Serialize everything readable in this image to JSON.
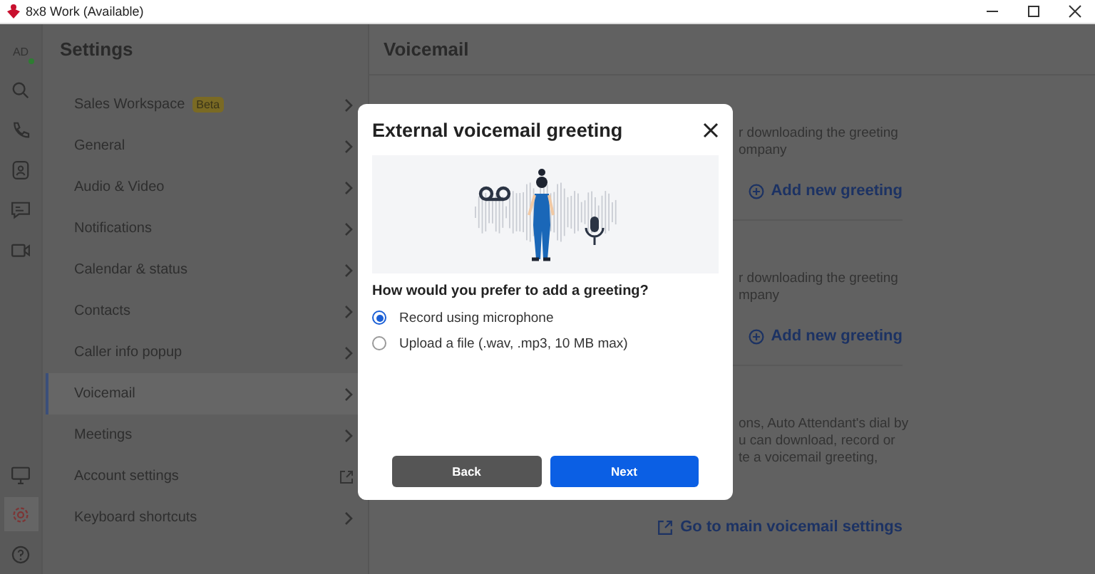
{
  "title_bar": {
    "title": "8x8 Work (Available)"
  },
  "rail": {
    "avatar": {
      "initials": "AD"
    },
    "items": [
      {
        "kind": "search",
        "selected": false
      },
      {
        "kind": "phone",
        "selected": false
      },
      {
        "kind": "contacts",
        "selected": false
      },
      {
        "kind": "chat",
        "selected": false
      },
      {
        "kind": "video",
        "selected": false
      }
    ],
    "bottom_items": [
      {
        "kind": "monitor",
        "selected": false
      },
      {
        "kind": "settings",
        "selected": true
      },
      {
        "kind": "help",
        "selected": false
      }
    ]
  },
  "settings": {
    "title": "Settings",
    "items": [
      {
        "label": "Sales Workspace",
        "badge": "Beta",
        "kind": "page",
        "selected": false
      },
      {
        "label": "General",
        "kind": "page",
        "selected": false
      },
      {
        "label": "Audio & Video",
        "kind": "page",
        "selected": false
      },
      {
        "label": "Notifications",
        "kind": "page",
        "selected": false
      },
      {
        "label": "Calendar & status",
        "kind": "page",
        "selected": false
      },
      {
        "label": "Contacts",
        "kind": "page",
        "selected": false
      },
      {
        "label": "Caller info popup",
        "kind": "page",
        "selected": false
      },
      {
        "label": "Voicemail",
        "kind": "page",
        "selected": true
      },
      {
        "label": "Meetings",
        "kind": "page",
        "selected": false
      },
      {
        "label": "Account settings",
        "kind": "external",
        "selected": false
      },
      {
        "label": "Keyboard shortcuts",
        "kind": "page",
        "selected": false
      }
    ]
  },
  "content": {
    "title": "Voicemail",
    "sections": [
      {
        "lines": [
          "r downloading the greeting",
          "ompany"
        ],
        "link": {
          "label": "Add new greeting",
          "kind": "add"
        }
      },
      {
        "lines": [
          "r downloading the greeting",
          "mpany"
        ],
        "link": {
          "label": "Add new greeting",
          "kind": "add"
        }
      },
      {
        "lines": [
          "ons, Auto Attendant's dial by",
          "u can download, record or",
          "te a voicemail greeting,"
        ],
        "link": {
          "label": "Go to main voicemail settings",
          "kind": "external"
        }
      }
    ]
  },
  "modal": {
    "title": "External voicemail greeting",
    "question": "How would you prefer to add a greeting?",
    "options": [
      {
        "label": "Record using microphone",
        "selected": true
      },
      {
        "label": "Upload a file (.wav, .mp3, 10 MB max)",
        "selected": false
      }
    ],
    "buttons": [
      {
        "label": "Back",
        "kind": "secondary"
      },
      {
        "label": "Next",
        "kind": "primary"
      }
    ]
  }
}
